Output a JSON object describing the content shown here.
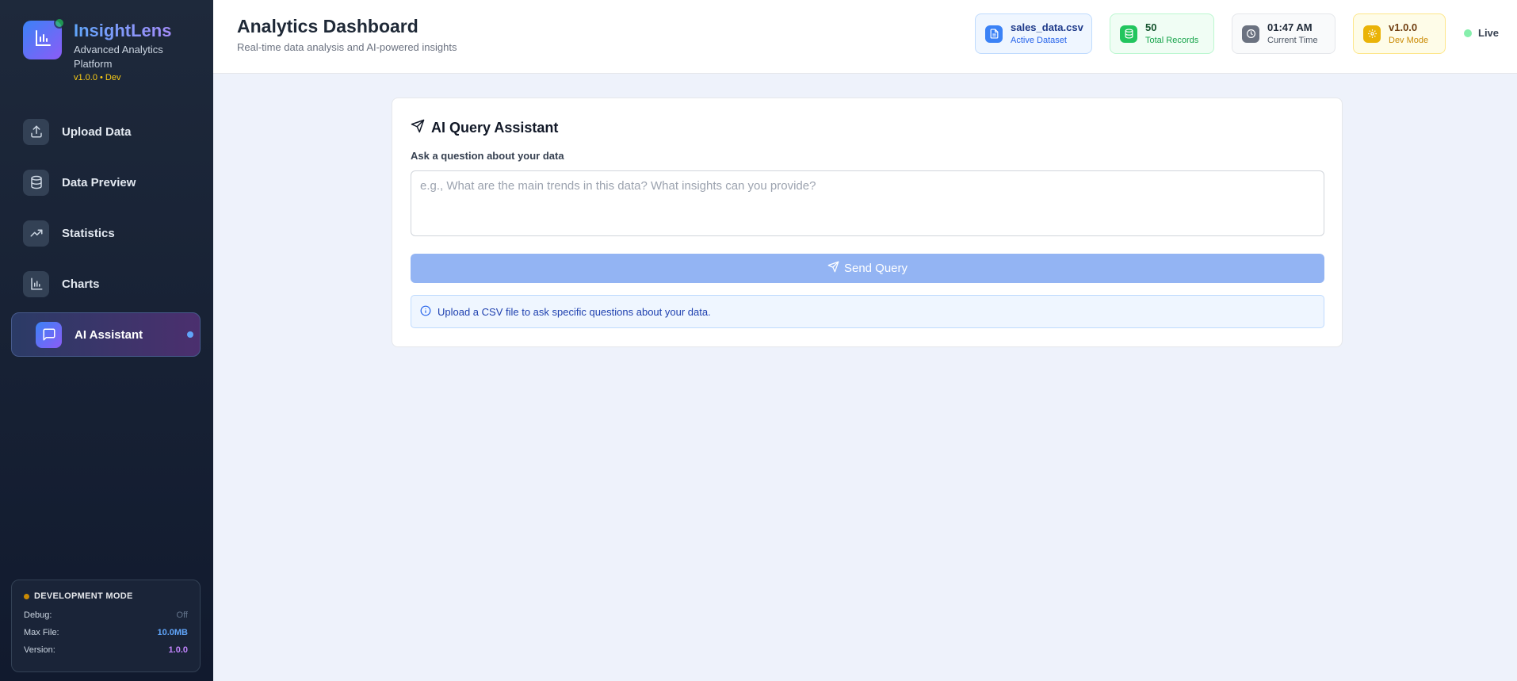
{
  "brand": {
    "name": "InsightLens",
    "subtitle": "Advanced Analytics Platform",
    "version_tag": "v1.0.0 • Dev"
  },
  "sidebar": {
    "items": [
      {
        "label": "Upload Data",
        "icon": "upload-icon",
        "active": false
      },
      {
        "label": "Data Preview",
        "icon": "database-icon",
        "active": false
      },
      {
        "label": "Statistics",
        "icon": "trending-up-icon",
        "active": false
      },
      {
        "label": "Charts",
        "icon": "bar-chart-icon",
        "active": false
      },
      {
        "label": "AI Assistant",
        "icon": "message-square-icon",
        "active": true
      }
    ]
  },
  "dev_panel": {
    "title": "DEVELOPMENT MODE",
    "rows": [
      {
        "label": "Debug:",
        "value": "Off"
      },
      {
        "label": "Max File:",
        "value": "10.0MB"
      },
      {
        "label": "Version:",
        "value": "1.0.0"
      }
    ]
  },
  "header": {
    "title": "Analytics Dashboard",
    "subtitle": "Real-time data analysis and AI-powered insights",
    "stats": [
      {
        "value": "sales_data.csv",
        "label": "Active Dataset",
        "icon": "file-icon",
        "color": "#3b82f6"
      },
      {
        "value": "50",
        "label": "Total Records",
        "icon": "database-icon",
        "color": "#22c55e"
      },
      {
        "value": "01:47 AM",
        "label": "Current Time",
        "icon": "clock-icon",
        "color": "#6b7280"
      },
      {
        "value": "v1.0.0",
        "label": "Dev Mode",
        "icon": "settings-icon",
        "color": "#eab308"
      }
    ],
    "live_label": "Live"
  },
  "assistant": {
    "title": "AI Query Assistant",
    "field_label": "Ask a question about your data",
    "query_value": "",
    "query_placeholder": "e.g., What are the main trends in this data? What insights can you provide?",
    "send_label": "Send Query",
    "info_text": "Upload a CSV file to ask specific questions about your data."
  }
}
